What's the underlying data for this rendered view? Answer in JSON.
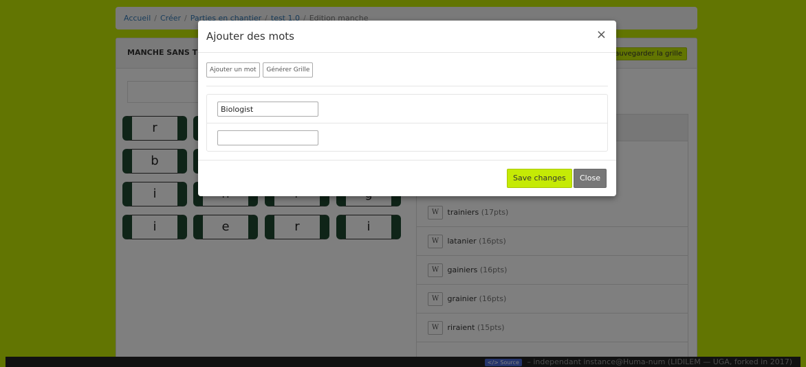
{
  "breadcrumb": {
    "items": [
      "Accueil",
      "Créer",
      "Parties en chantier",
      "test 1.0",
      "Edition manche"
    ],
    "separator": "/"
  },
  "panel": {
    "title": "MANCHE SANS TI",
    "save_grid_label": "Sauvegarder la grille"
  },
  "grid": {
    "rows": [
      [
        "r",
        "",
        "",
        ""
      ],
      [
        "b",
        "",
        "",
        ""
      ],
      [
        "i",
        "n",
        "r",
        "g"
      ],
      [
        "i",
        "e",
        "r",
        "i"
      ]
    ]
  },
  "words": [
    {
      "word": "trainiers",
      "points": "(17pts)"
    },
    {
      "word": "latanier",
      "points": "(16pts)"
    },
    {
      "word": "gainiers",
      "points": "(16pts)"
    },
    {
      "word": "grainier",
      "points": "(16pts)"
    },
    {
      "word": "riraient",
      "points": "(15pts)"
    }
  ],
  "word_button_icon": "W",
  "footer": {
    "badge": "</> Source",
    "text": " – independant instance@Huma-num (LIDILEM — UGA, forked in 2017)"
  },
  "modal": {
    "title": "Ajouter des mots",
    "close_icon": "×",
    "add_word_label": "Ajouter un mot",
    "generate_grid_label": "Générer Grille",
    "entries": [
      {
        "value": "Biologist"
      },
      {
        "value": ""
      }
    ],
    "save_label": "Save changes",
    "close_label": "Close"
  },
  "colors": {
    "brand_green": "#c5ea05",
    "tile_dark": "#1e4930",
    "close_gray": "#777777"
  }
}
